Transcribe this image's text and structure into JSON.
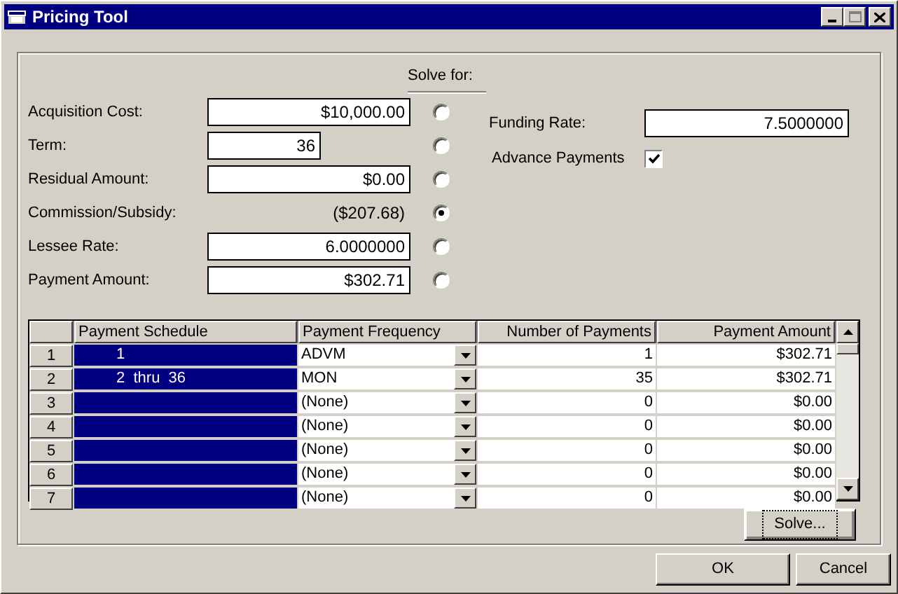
{
  "window": {
    "title": "Pricing Tool"
  },
  "solve_for_label": "Solve for:",
  "fields": [
    {
      "label": "Acquisition Cost:",
      "kind": "input",
      "value": "$10,000.00",
      "selected": false
    },
    {
      "label": "Term:",
      "kind": "short_input",
      "value": "36",
      "selected": false
    },
    {
      "label": "Residual Amount:",
      "kind": "input",
      "value": "$0.00",
      "selected": false
    },
    {
      "label": "Commission/Subsidy:",
      "kind": "readout",
      "value": "($207.68)",
      "selected": true
    },
    {
      "label": "Lessee Rate:",
      "kind": "input",
      "value": "6.0000000",
      "selected": false
    },
    {
      "label": "Payment Amount:",
      "kind": "input",
      "value": "$302.71",
      "selected": false
    }
  ],
  "funding_rate": {
    "label": "Funding Rate:",
    "value": "7.5000000"
  },
  "advance_payments": {
    "label": "Advance Payments",
    "checked": true
  },
  "table": {
    "columns": [
      "Payment Schedule",
      "Payment Frequency",
      "Number of Payments",
      "Payment Amount"
    ],
    "rows": [
      {
        "number": "1",
        "schedule": "1",
        "frequency": "ADVM",
        "count": "1",
        "amount": "$302.71",
        "selected": true
      },
      {
        "number": "2",
        "schedule": "2  thru  36",
        "frequency": "MON",
        "count": "35",
        "amount": "$302.71",
        "selected": true
      },
      {
        "number": "3",
        "frequency": "(None)",
        "count": "0",
        "amount": "$0.00",
        "selected": true
      },
      {
        "number": "4",
        "frequency": "(None)",
        "count": "0",
        "amount": "$0.00",
        "selected": true
      },
      {
        "number": "5",
        "frequency": "(None)",
        "count": "0",
        "amount": "$0.00",
        "selected": true
      },
      {
        "number": "6",
        "frequency": "(None)",
        "count": "0",
        "amount": "$0.00",
        "selected": true
      },
      {
        "number": "7",
        "frequency": "(None)",
        "count": "0",
        "amount": "$0.00",
        "selected": true
      }
    ]
  },
  "buttons": [
    {
      "label": "Solve...",
      "focused": true
    },
    {
      "label": "OK",
      "focused": false
    },
    {
      "label": "Cancel",
      "focused": false
    }
  ]
}
